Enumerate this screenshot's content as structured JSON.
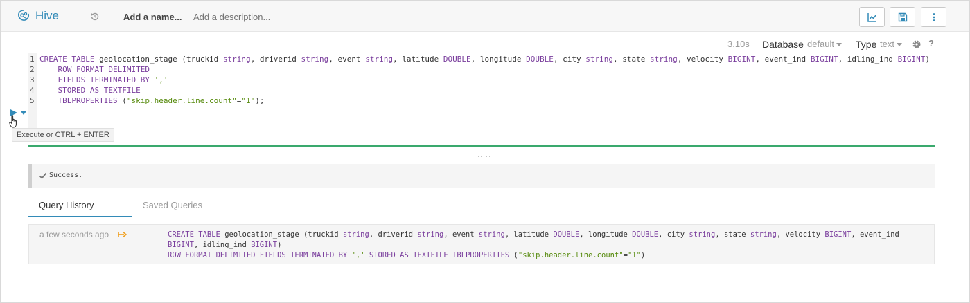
{
  "header": {
    "app_name": "Hive",
    "name_placeholder": "Add a name...",
    "description_placeholder": "Add a description...",
    "icons": [
      "hive-logo-icon",
      "history-icon",
      "chart-icon",
      "save-icon",
      "more-icon"
    ]
  },
  "toolbar": {
    "duration": "3.10s",
    "database_label": "Database",
    "database_value": "default",
    "type_label": "Type",
    "type_value": "text",
    "help": "?"
  },
  "editor": {
    "line_numbers": [
      "1",
      "2",
      "3",
      "4",
      "5"
    ],
    "lines": [
      "CREATE TABLE geolocation_stage (truckid string, driverid string, event string, latitude DOUBLE, longitude DOUBLE, city string, state string, velocity BIGINT, event_ind BIGINT, idling_ind BIGINT)",
      "    ROW FORMAT DELIMITED",
      "    FIELDS TERMINATED BY ','",
      "    STORED AS TEXTFILE",
      "    TBLPROPERTIES (\"skip.header.line.count\"=\"1\");"
    ],
    "execute_tooltip": "Execute or CTRL + ENTER"
  },
  "result": {
    "message": "Success."
  },
  "tabs": [
    {
      "label": "Query History",
      "active": true
    },
    {
      "label": "Saved Queries",
      "active": false
    }
  ],
  "history": [
    {
      "time": "a few seconds ago",
      "query_lines": [
        "CREATE TABLE geolocation_stage (truckid string, driverid string, event string, latitude DOUBLE, longitude DOUBLE, city string, state string, velocity BIGINT, event_ind",
        "BIGINT, idling_ind BIGINT)",
        "ROW FORMAT DELIMITED FIELDS TERMINATED BY ',' STORED AS TEXTFILE TBLPROPERTIES (\"skip.header.line.count\"=\"1\")"
      ]
    }
  ],
  "colors": {
    "brand": "#338bb8",
    "success_bar": "#3aa96d",
    "keyword": "#7a3e9d",
    "string_literal": "#568a0c",
    "star": "#f0a020"
  }
}
